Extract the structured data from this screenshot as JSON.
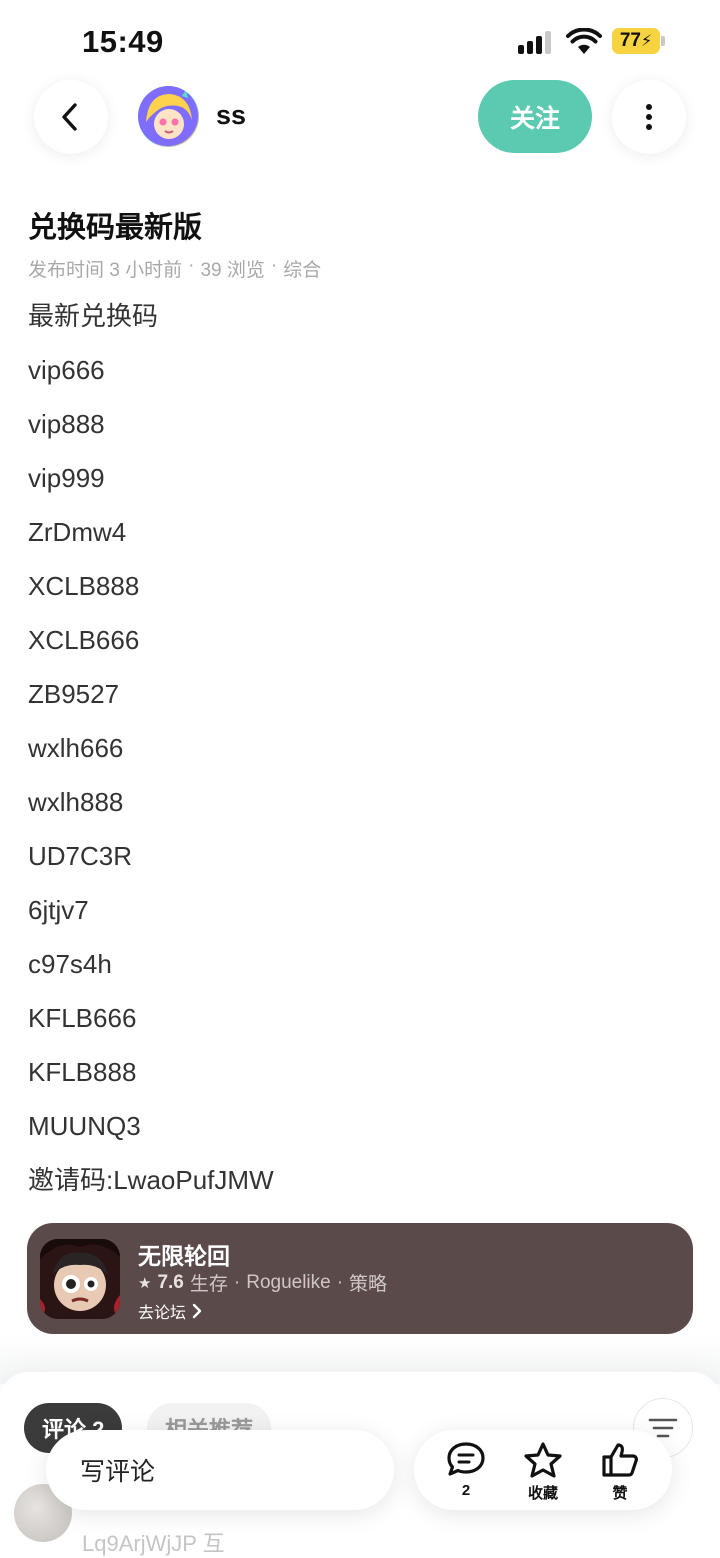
{
  "status_bar": {
    "time": "15:49",
    "battery": "77"
  },
  "header": {
    "username": "ss",
    "follow_label": "关注"
  },
  "post": {
    "title": "兑换码最新版",
    "meta": {
      "time": "发布时间 3 小时前",
      "views": "39 浏览",
      "category": "综合",
      "separator": "·"
    },
    "lines": [
      "最新兑换码",
      "vip666",
      "vip888",
      "vip999",
      "ZrDmw4",
      "XCLB888",
      "XCLB666",
      "ZB9527",
      "wxlh666",
      "wxlh888",
      "UD7C3R",
      "6jtjv7",
      "c97s4h",
      "KFLB666",
      "KFLB888",
      "MUUNQ3",
      "邀请码:LwaoPufJMW"
    ]
  },
  "game_card": {
    "name": "无限轮回",
    "rating": "7.6",
    "tags": [
      "生存",
      "Roguelike",
      "策略"
    ],
    "separator": "·",
    "link_label": "去论坛"
  },
  "comments": {
    "tabs": [
      {
        "label": "评论 2",
        "active": true
      },
      {
        "label": "相关推荐",
        "active": false
      }
    ],
    "preview_text": "Lq9ArjWjJP 互"
  },
  "bottom_bar": {
    "write_placeholder": "写评论",
    "comment_count": "2",
    "favorite_label": "收藏",
    "like_label": "赞"
  },
  "colors": {
    "accent": "#5ccab0",
    "card_bg": "#5a4a4a",
    "battery": "#f6d33f"
  }
}
